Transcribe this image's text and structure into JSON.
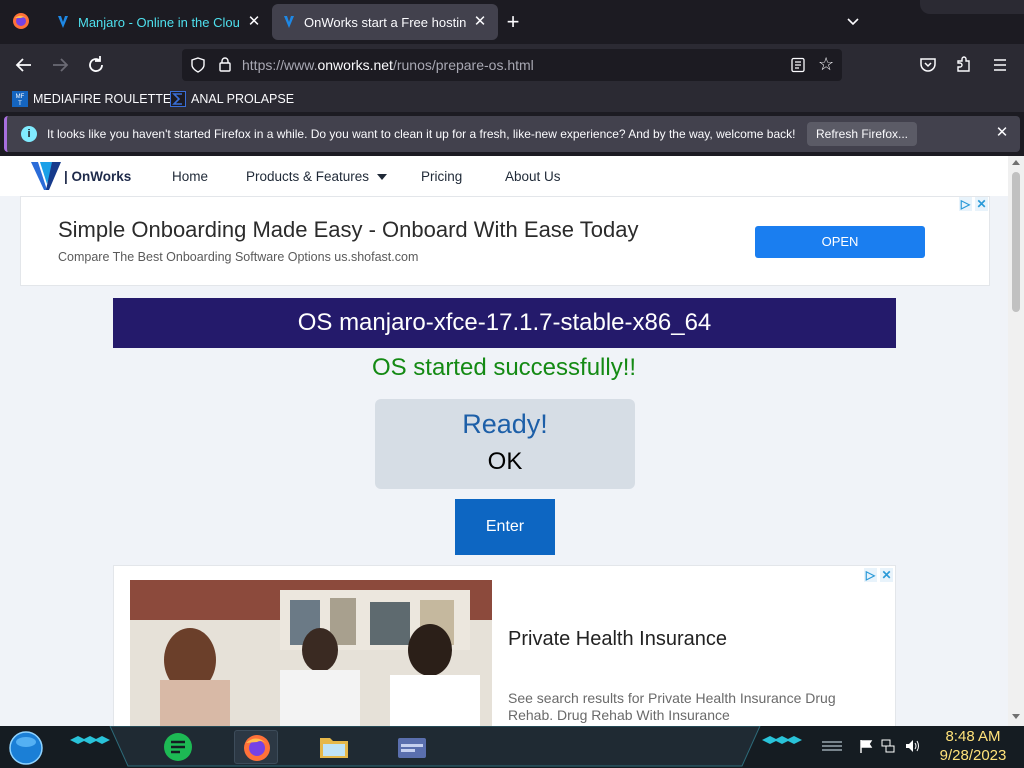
{
  "browser": {
    "tabs": [
      {
        "title": "Manjaro - Online in the Cloud",
        "active": false
      },
      {
        "title": "OnWorks start a Free hosting pl",
        "active": true
      }
    ],
    "url_prefix": "https://www.",
    "url_domain": "onworks.net",
    "url_path": "/runos/prepare-os.html",
    "bookmarks": [
      {
        "label": "MEDIAFIRE ROULETTER",
        "icon": "mediafire-icon"
      },
      {
        "label": "ANAL PROLAPSE",
        "icon": "bookmark-sigma-icon"
      }
    ],
    "notification": {
      "message": "It looks like you haven't started Firefox in a while. Do you want to clean it up for a fresh, like-new experience? And by the way, welcome back!",
      "button": "Refresh Firefox..."
    }
  },
  "site": {
    "brand": "| OnWorks",
    "nav": [
      "Home",
      "Products & Features",
      "Pricing",
      "About Us"
    ]
  },
  "ad_top": {
    "headline": "Simple Onboarding Made Easy - Onboard With Ease Today",
    "subline": "Compare The Best Onboarding Software Options us.shofast.com",
    "button": "OPEN"
  },
  "os": {
    "title": "OS manjaro-xfce-17.1.7-stable-x86_64",
    "status": "OS started successfully!!",
    "ready": "Ready!",
    "ok": "OK",
    "enter": "Enter"
  },
  "ad_bottom": {
    "headline": "Private Health Insurance",
    "subline": "See search results for Private Health Insurance Drug Rehab. Drug Rehab With Insurance"
  },
  "taskbar": {
    "time": "8:48 AM",
    "date": "9/28/2023"
  },
  "colors": {
    "os_title_bg": "#241a6b",
    "status_green": "#148a14",
    "enter_blue": "#0d66c2",
    "ad_button_blue": "#1a7ef0",
    "clock_yellow": "#ffe27a"
  }
}
